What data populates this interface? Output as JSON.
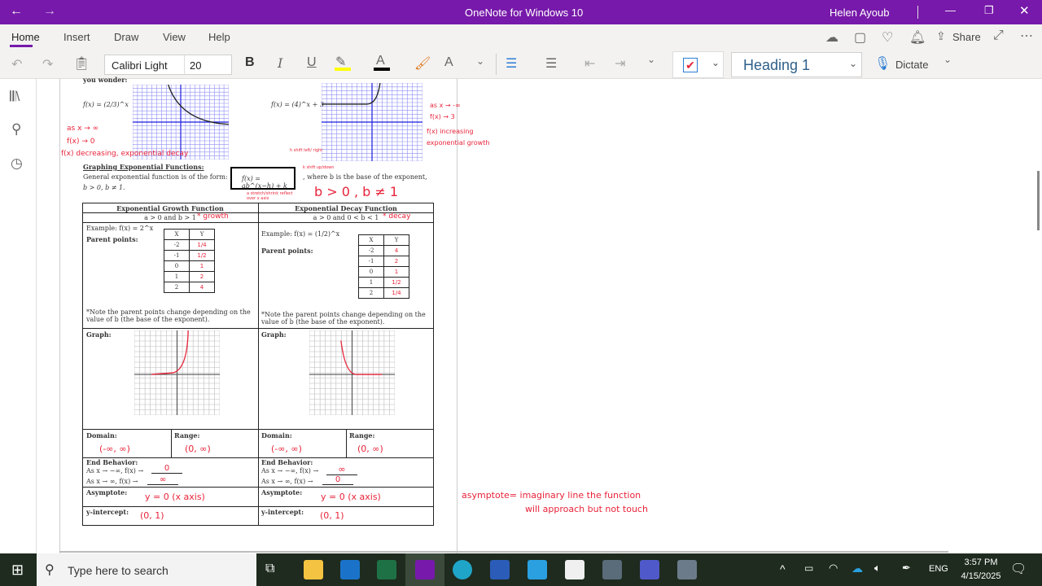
{
  "window": {
    "title": "OneNote for Windows 10",
    "user": "Helen Ayoub"
  },
  "tabs": [
    "Home",
    "Insert",
    "Draw",
    "View",
    "Help"
  ],
  "ribbon_right": {
    "share": "Share"
  },
  "toolbar": {
    "font": "Calibri Light",
    "size": "20",
    "style": "Heading 1",
    "dictate": "Dictate",
    "bold": "B",
    "italic": "I",
    "underline": "U",
    "font_color": "A"
  },
  "colors": {
    "accent": "#7719aa",
    "ink": "#e8243a",
    "highlight": "#ffff00"
  },
  "doc": {
    "cut_line": "you wonder:",
    "f1": "f(x) = (2/3)^x",
    "f2": "f(x) = (4)^x + 3",
    "notes_left": [
      "as x → ∞",
      "f(x) → 0",
      "f(x) decreasing, exponential decay"
    ],
    "notes_right": [
      "as x → -∞",
      "f(x) → 3",
      "f(x) increasing",
      "exponential growth"
    ],
    "heading": "Graphing Exponential Functions:",
    "general": "General exponential function is of the form:",
    "conditions": "b > 0, b ≠ 1.",
    "formula": "f(x) = ab^(x−h) + k",
    "where": ", where b is the base of the exponent,",
    "red_conditions": "b > 0 ,  b ≠ 1",
    "ann_h": "h shift left/ right",
    "ann_k": "k shift up/down",
    "ann_a": "a stretch/shrink reflect over x axis",
    "growth": {
      "title": "Exponential Growth Function",
      "cond": "a > 0 and b > 1",
      "ink": "* growth",
      "example": "Example: f(x) = 2^x",
      "parent": "Parent points:",
      "table": {
        "headers": [
          "X",
          "Y"
        ],
        "x": [
          "-2",
          "-1",
          "0",
          "1",
          "2"
        ],
        "y": [
          "1/4",
          "1/2",
          "1",
          "2",
          "4"
        ]
      },
      "note": "*Note the parent points change depending on the value of b (the base of the exponent).",
      "graph": "Graph:",
      "domain_label": "Domain:",
      "domain": "(-∞, ∞)",
      "range_label": "Range:",
      "range": "(0, ∞)",
      "end_label": "End Behavior:",
      "end1": "As x → −∞, f(x) →",
      "end1_val": "0",
      "end2": "As x → ∞, f(x) →",
      "end2_val": "∞",
      "asym_label": "Asymptote:",
      "asym": "y = 0  (x axis)",
      "yint_label": "y-intercept:",
      "yint": "(0, 1)"
    },
    "decay": {
      "title": "Exponential Decay Function",
      "cond": "a > 0 and 0 < b < 1",
      "ink": "* decay",
      "example": "Example: f(x) = (1/2)^x",
      "parent": "Parent points:",
      "table": {
        "headers": [
          "X",
          "Y"
        ],
        "x": [
          "-2",
          "-1",
          "0",
          "1",
          "2"
        ],
        "y": [
          "4",
          "2",
          "1",
          "1/2",
          "1/4"
        ]
      },
      "note": "*Note the parent points change depending on the value of b (the base of the exponent).",
      "graph": "Graph:",
      "domain_label": "Domain:",
      "domain": "(-∞, ∞)",
      "range_label": "Range:",
      "range": "(0, ∞)",
      "end_label": "End Behavior:",
      "end1": "As x → −∞, f(x) →",
      "end1_val": "∞",
      "end2": "As x → ∞, f(x) →",
      "end2_val": "0",
      "asym_label": "Asymptote:",
      "asym": "y = 0  (x axis)",
      "yint_label": "y-intercept:",
      "yint": "(0, 1)"
    },
    "asym_note": [
      "asymptote= imaginary line the function",
      "will approach but not touch"
    ]
  },
  "taskbar": {
    "search": "Type here to search",
    "lang": "ENG",
    "time": "3:57 PM",
    "date": "4/15/2025"
  }
}
